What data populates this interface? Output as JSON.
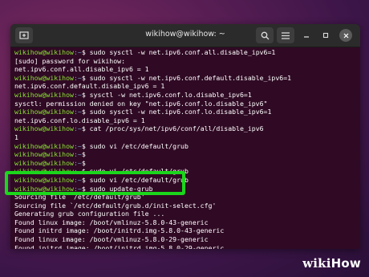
{
  "window": {
    "title": "wikihow@wikihow: ~",
    "new_tab_icon": "new-tab-icon",
    "search_icon": "search-icon",
    "menu_icon": "hamburger-menu-icon"
  },
  "prompt": {
    "user": "wikihow@wikihow",
    "path": ":~",
    "symbol": "$ "
  },
  "lines": [
    {
      "type": "prompt",
      "cmd": "sudo sysctl -w net.ipv6.conf.all.disable_ipv6=1"
    },
    {
      "type": "out",
      "text": "[sudo] password for wikihow:"
    },
    {
      "type": "out",
      "text": "net.ipv6.conf.all.disable_ipv6 = 1"
    },
    {
      "type": "prompt",
      "cmd": "sudo sysctl -w net.ipv6.conf.default.disable_ipv6=1"
    },
    {
      "type": "out",
      "text": "net.ipv6.conf.default.disable_ipv6 = 1"
    },
    {
      "type": "prompt",
      "cmd": "sysctl -w net.ipv6.conf.lo.disable_ipv6=1"
    },
    {
      "type": "out",
      "text": "sysctl: permission denied on key \"net.ipv6.conf.lo.disable_ipv6\""
    },
    {
      "type": "prompt",
      "cmd": "sudo sysctl -w net.ipv6.conf.lo.disable_ipv6=1"
    },
    {
      "type": "out",
      "text": "net.ipv6.conf.lo.disable_ipv6 = 1"
    },
    {
      "type": "prompt",
      "cmd": "cat /proc/sys/net/ipv6/conf/all/disable_ipv6"
    },
    {
      "type": "out",
      "text": "1"
    },
    {
      "type": "prompt",
      "cmd": "sudo vi /etc/default/grub"
    },
    {
      "type": "prompt",
      "cmd": ""
    },
    {
      "type": "prompt",
      "cmd": ""
    },
    {
      "type": "prompt",
      "cmd": "sudo vi /etc/default/grub"
    },
    {
      "type": "prompt",
      "cmd": "sudo vi /etc/default/grub"
    },
    {
      "type": "prompt",
      "cmd": "sudo update-grub"
    },
    {
      "type": "out",
      "text": "Sourcing file `/etc/default/grub'"
    },
    {
      "type": "out",
      "text": "Sourcing file `/etc/default/grub.d/init-select.cfg'"
    },
    {
      "type": "out",
      "text": "Generating grub configuration file ..."
    },
    {
      "type": "out",
      "text": "Found linux image: /boot/vmlinuz-5.8.0-43-generic"
    },
    {
      "type": "out",
      "text": "Found initrd image: /boot/initrd.img-5.8.0-43-generic"
    },
    {
      "type": "out",
      "text": "Found linux image: /boot/vmlinuz-5.8.0-29-generic"
    },
    {
      "type": "out",
      "text": "Found initrd image: /boot/initrd.img-5.8.0-29-generic"
    }
  ],
  "watermark": {
    "wiki": "wiki",
    "how": "How"
  },
  "colors": {
    "terminal_bg": "#300a24",
    "prompt_user": "#8ae234",
    "prompt_path": "#729fcf",
    "highlight": "#1bd61b"
  }
}
